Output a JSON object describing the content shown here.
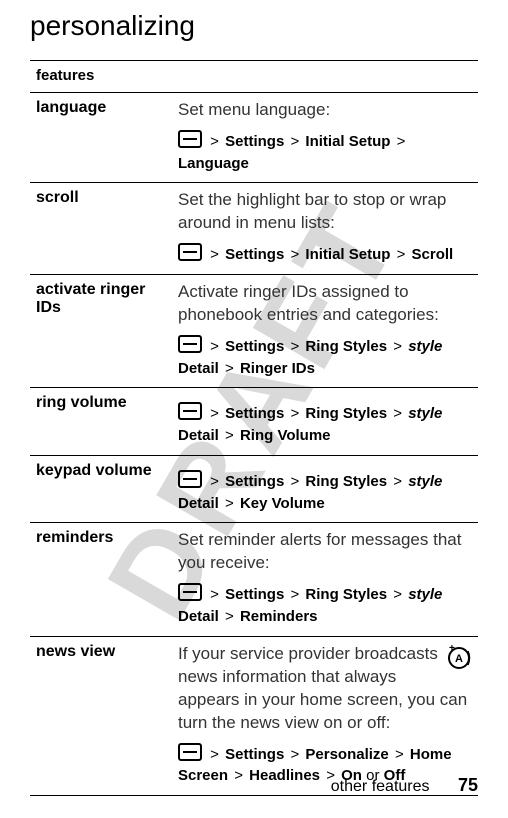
{
  "page": {
    "title": "personalizing",
    "watermark": "DRAFT",
    "footer_text": "other features",
    "page_number": "75"
  },
  "table": {
    "header": "features",
    "rows": [
      {
        "name": "language",
        "desc": "Set menu language:",
        "path_segments": [
          "Settings",
          "Initial Setup",
          "Language"
        ]
      },
      {
        "name": "scroll",
        "desc": "Set the highlight bar to stop or wrap around in menu lists:",
        "path_segments": [
          "Settings",
          "Initial Setup",
          "Scroll"
        ]
      },
      {
        "name": "activate ringer IDs",
        "desc": "Activate ringer IDs assigned to phonebook entries and categories:",
        "path_segments": [
          "Settings",
          "Ring Styles",
          "style",
          "Detail",
          "Ringer IDs"
        ],
        "italic_index": 2
      },
      {
        "name": "ring volume",
        "desc": "",
        "path_segments": [
          "Settings",
          "Ring Styles",
          "style",
          "Detail",
          "Ring Volume"
        ],
        "italic_index": 2
      },
      {
        "name": "keypad volume",
        "desc": "",
        "path_segments": [
          "Settings",
          "Ring Styles",
          "style",
          "Detail",
          "Key Volume"
        ],
        "italic_index": 2
      },
      {
        "name": "reminders",
        "desc": "Set reminder alerts for messages that you receive:",
        "path_segments": [
          "Settings",
          "Ring Styles",
          "style",
          "Detail",
          "Reminders"
        ],
        "italic_index": 2
      },
      {
        "name": "news view",
        "desc": "If your service provider broadcasts news information that always appears in your home screen, you can turn the news view on or off:",
        "path_segments": [
          "Settings",
          "Personalize",
          "Home Screen",
          "Headlines",
          "On",
          "Off"
        ],
        "or_index": 4,
        "has_icon": true
      }
    ]
  },
  "labels": {
    "sep": ">",
    "or": "or"
  }
}
